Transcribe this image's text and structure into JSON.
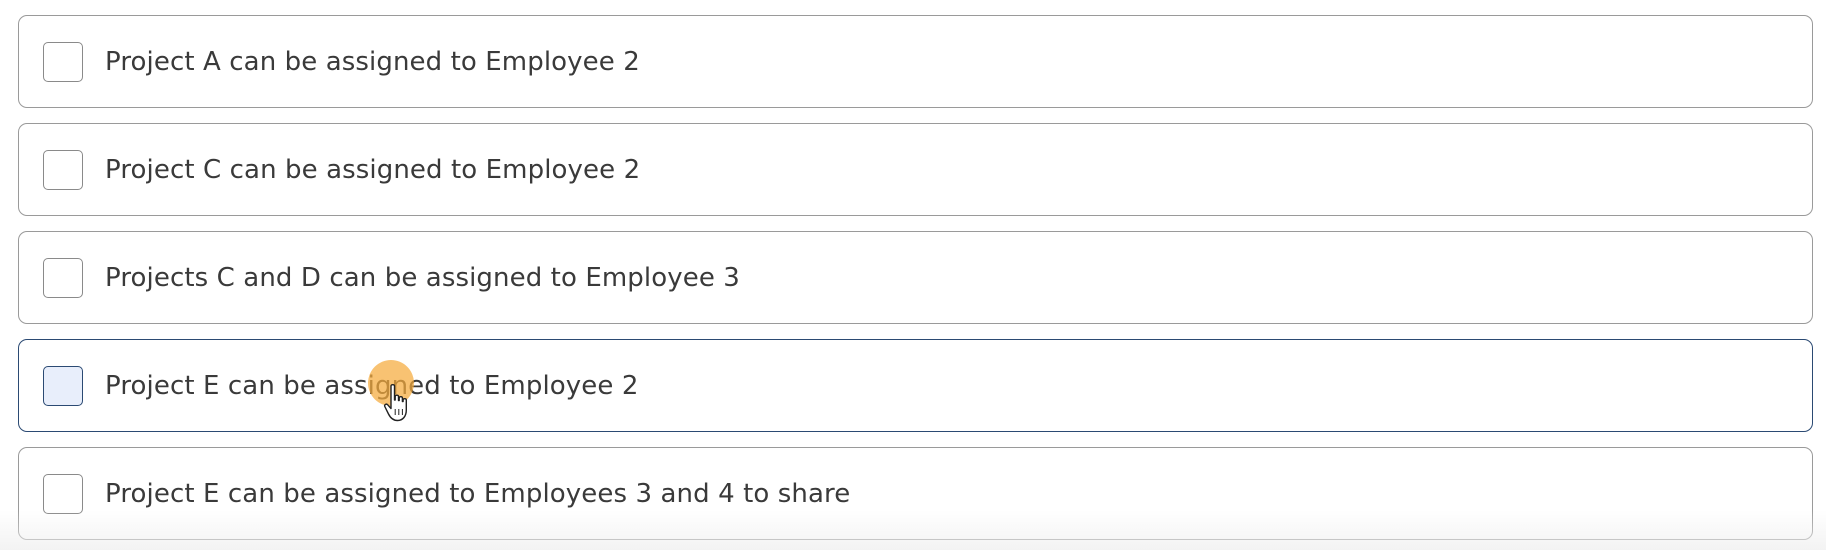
{
  "options": [
    {
      "label": "Project A can be assigned to Employee 2",
      "checked": false
    },
    {
      "label": "Project C can be assigned to Employee 2",
      "checked": false
    },
    {
      "label": "Projects C and D can be assigned to Employee 3",
      "checked": false
    },
    {
      "label": "Project E can be assigned to Employee 2",
      "checked": false,
      "hovered": true
    },
    {
      "label": "Project E can be assigned to Employees 3 and 4 to share",
      "checked": false
    }
  ],
  "colors": {
    "border": "#9a9a9a",
    "hover_border": "#2b4a73",
    "hover_checkbox_fill": "#e8eefb",
    "text": "#3a3a3a",
    "cursor_highlight": "#f5aa3c"
  },
  "cursor": {
    "icon": "hand-pointer-icon"
  }
}
